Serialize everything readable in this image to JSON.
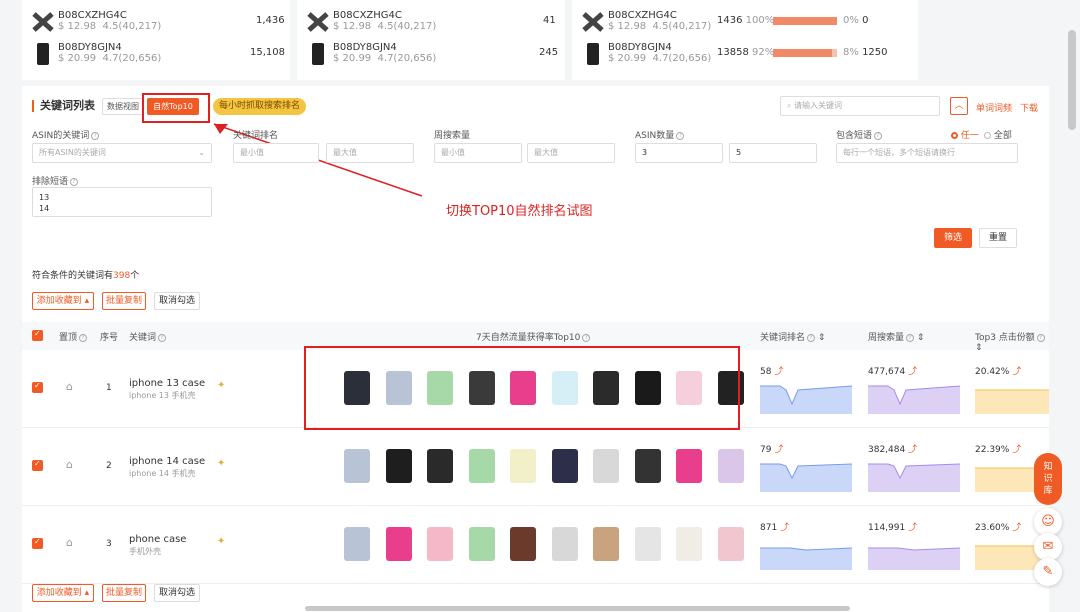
{
  "top_cards": [
    {
      "rows": [
        {
          "asin": "B08CXZHG4C",
          "price": "$ 12.98",
          "rating": "4.5(40,217)",
          "value": "1,436"
        },
        {
          "asin": "B08DY8GJN4",
          "price": "$ 20.99",
          "rating": "4.7(20,656)",
          "value": "15,108"
        }
      ]
    },
    {
      "rows": [
        {
          "asin": "B08CXZHG4C",
          "price": "$ 12.98",
          "rating": "4.5(40,217)",
          "value": "41"
        },
        {
          "asin": "B08DY8GJN4",
          "price": "$ 20.99",
          "rating": "4.7(20,656)",
          "value": "245"
        }
      ]
    },
    {
      "rows": [
        {
          "asin": "B08CXZHG4C",
          "price": "$ 12.98",
          "rating": "4.5(40,217)",
          "left_value": "1436",
          "left_pct": "100%",
          "left_fill": 1.0,
          "right_pct": "0%",
          "right_value": "0"
        },
        {
          "asin": "B08DY8GJN4",
          "price": "$ 20.99",
          "rating": "4.7(20,656)",
          "left_value": "13858",
          "left_pct": "92%",
          "left_fill": 0.92,
          "right_pct": "8%",
          "right_value": "1250"
        }
      ]
    }
  ],
  "header": {
    "title": "关键词列表",
    "tab_data_view": "数据视图",
    "tab_top10": "自然Top10",
    "hourly_pill": "每小时抓取搜索排名",
    "search_placeholder": "请输入关键词",
    "single_freq": "单词词频",
    "download": "下载"
  },
  "filters": {
    "asin_keywords_label": "ASIN的关键词",
    "asin_keywords_value": "所有ASIN的关键词",
    "rank_label": "关键词排名",
    "rank_min": "最小值",
    "rank_max": "最大值",
    "weekly_label": "周搜索量",
    "weekly_min": "最小值",
    "weekly_max": "最大值",
    "asin_count_label": "ASIN数量",
    "asin_count_min": "3",
    "asin_count_max": "5",
    "include_label": "包含短语",
    "include_any": "任一",
    "include_all": "全部",
    "include_placeholder": "每行一个短语，多个短语请换行",
    "exclude_label": "排除短语",
    "exclude_lines": [
      "13",
      "14"
    ],
    "filter_btn": "筛选",
    "reset_btn": "重置"
  },
  "annotation": {
    "text": "切换TOP10自然排名试图"
  },
  "summary": {
    "prefix": "符合条件的关键词有",
    "count": "398",
    "suffix": "个"
  },
  "actions": {
    "add_fav": "添加收藏到 ▴",
    "batch_copy": "批量复制",
    "cancel_select": "取消勾选"
  },
  "table": {
    "headers": {
      "pin": "置顶",
      "index": "序号",
      "keyword": "关键词",
      "top10": "7天自然流量获得率Top10",
      "rank": "关键词排名",
      "weekly": "周搜索量",
      "top3": "Top3 点击份额"
    },
    "rows": [
      {
        "index": "1",
        "keyword": "iphone 13 case",
        "sub": "iphone 13 手机壳",
        "rank": "58",
        "weekly": "477,674",
        "top3": "20.42%",
        "thumbs": [
          "#2a2f3a",
          "#b8c4d6",
          "#a7d8a8",
          "#3a3a3a",
          "#e83e8c",
          "#d6eef5",
          "#2b2b2b",
          "#1a1a1a",
          "#f5d0dc",
          "#222"
        ]
      },
      {
        "index": "2",
        "keyword": "iphone 14 case",
        "sub": "iphone 14 手机壳",
        "rank": "79",
        "weekly": "382,484",
        "top3": "22.39%",
        "thumbs": [
          "#b8c4d6",
          "#1e1e1e",
          "#2a2a2a",
          "#a7d8a8",
          "#f1f0c8",
          "#2d2f4a",
          "#d8d8d8",
          "#333",
          "#e83e8c",
          "#d9c6e8"
        ]
      },
      {
        "index": "3",
        "keyword": "phone case",
        "sub": "手机外壳",
        "rank": "871",
        "weekly": "114,991",
        "top3": "23.60%",
        "thumbs": [
          "#b8c4d6",
          "#e83e8c",
          "#f5b8c8",
          "#a7d8a8",
          "#6b3a2a",
          "#d8d8d8",
          "#c9a27e",
          "#e5e5e5",
          "#f0ece6",
          "#f2c6cf"
        ]
      }
    ]
  }
}
